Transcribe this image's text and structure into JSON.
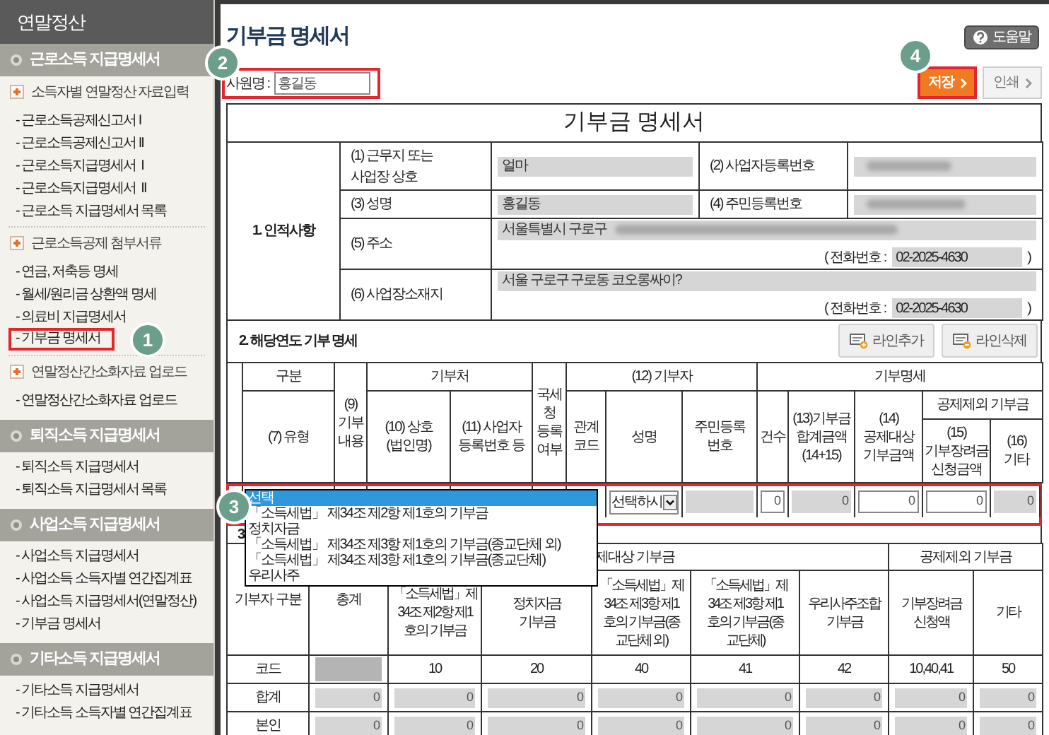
{
  "sidebar": {
    "title": "연말정산",
    "sections": [
      {
        "title": "근로소득 지급명세서",
        "groups": [
          {
            "heading": "소득자별 연말정산 자료입력",
            "items": [
              {
                "label": "- 근로소득공제신고서 I",
                "highlighted": false
              },
              {
                "label": "- 근로소득공제신고서 II",
                "highlighted": false
              },
              {
                "label": "- 근로소득지급명세서  I",
                "highlighted": false
              },
              {
                "label": "- 근로소득지급명세서  II",
                "highlighted": false
              },
              {
                "label": "- 근로소득 지급명세서 목록",
                "highlighted": false
              }
            ]
          },
          {
            "heading": "근로소득공제 첨부서류",
            "items": [
              {
                "label": "- 연금, 저축등 명세",
                "highlighted": false
              },
              {
                "label": "- 월세/원리금 상환액 명세",
                "highlighted": false
              },
              {
                "label": "- 의료비 지급명세서",
                "highlighted": false
              },
              {
                "label": "- 기부금 명세서",
                "highlighted": true,
                "callout": "1"
              }
            ]
          },
          {
            "heading": "연말정산간소화자료 업로드",
            "items": [
              {
                "label": "- 연말정산간소화자료 업로드",
                "highlighted": false
              }
            ]
          }
        ]
      },
      {
        "title": "퇴직소득 지급명세서",
        "groups": [
          {
            "items": [
              {
                "label": "- 퇴직소득 지급명세서",
                "highlighted": false
              },
              {
                "label": "- 퇴직소득 지급명세서 목록",
                "highlighted": false
              }
            ]
          }
        ]
      },
      {
        "title": "사업소득 지급명세서",
        "groups": [
          {
            "items": [
              {
                "label": "- 사업소득 지급명세서",
                "highlighted": false
              },
              {
                "label": "- 사업소득 소득자별 연간집계표",
                "highlighted": false
              },
              {
                "label": "- 사업소득 지급명세서(연말정산)",
                "highlighted": false
              },
              {
                "label": "- 기부금 명세서",
                "highlighted": false
              }
            ]
          }
        ]
      },
      {
        "title": "기타소득 지급명세서",
        "groups": [
          {
            "items": [
              {
                "label": "- 기타소득 지급명세서",
                "highlighted": false
              },
              {
                "label": "- 기타소득 소득자별 연간집계표",
                "highlighted": false
              }
            ]
          }
        ]
      }
    ]
  },
  "page": {
    "title": "기부금 명세서",
    "help_button": "도움말",
    "employee": {
      "label": "사원명 :",
      "value": "홍길동",
      "callout": "2"
    },
    "buttons": [
      {
        "label": "저장",
        "kind": "primary",
        "callout": "4"
      },
      {
        "label": "인쇄",
        "kind": "secondary"
      }
    ]
  },
  "form": {
    "title": "기부금 명세서",
    "personal": {
      "heading": "1. 인적사항",
      "workplace": {
        "label": "(1) 근무지 또는\n사업장 상호",
        "value": "얼마"
      },
      "business_no": {
        "label": "(2) 사업자등록번호",
        "redacted": true
      },
      "name": {
        "label": "(3) 성명",
        "value": "홍길동"
      },
      "resident_no": {
        "label": "(4) 주민등록번호",
        "redacted": true
      },
      "address": {
        "label": "(5) 주소",
        "value": "서울특별시 구로구",
        "redacted": true,
        "phone_label": "( 전화번호 :",
        "phone": "02-2025-4630",
        "phone_close": ")"
      },
      "business_address": {
        "label": "(6) 사업장소재지",
        "value": "서울 구로구 구로동 코오롱싸이?",
        "redacted": false,
        "phone_label": "( 전화번호 :",
        "phone": "02-2025-4630",
        "phone_close": ")"
      }
    },
    "donations": {
      "heading": "2. 해당연도 기부 명세",
      "buttons": [
        {
          "label": "라인추가",
          "kind": "add"
        },
        {
          "label": "라인삭제",
          "kind": "delete"
        }
      ],
      "headers": {
        "type_group": "구분",
        "type": "(7) 유형",
        "content": "(9)\n기부\n내용",
        "org_group": "기부처",
        "org_name": "(10) 상호\n(법인명)",
        "org_regno": "(11) 사업자\n등록번호 등",
        "nts": "국세\n청\n등록\n여부",
        "donor_group": "(12) 기부자",
        "relation": "관계\n코드",
        "name": "성명",
        "resident_no": "주민등록\n번호",
        "detail_group": "기부명세",
        "count": "건수",
        "total": "(13)기부금\n합계금액\n(14+15)",
        "deductible": "(14)\n공제대상\n기부금액",
        "excluded_group": "공제제외 기부금",
        "incentive": "(15)\n기부장려금\n신청금액",
        "other": "(16)\n기타"
      },
      "entry_row": {
        "callout": "3",
        "type_options": [
          {
            "label": "선택",
            "selected": true
          },
          {
            "label": "「소득세법」 제34조 제2항 제1호의 기부금",
            "selected": false
          },
          {
            "label": "정치자금",
            "selected": false
          },
          {
            "label": "「소득세법」 제34조 제3항 제1호의 기부금(종교단체 외)",
            "selected": false
          },
          {
            "label": "「소득세법」 제34조 제3항 제1호의 기부금(종교단체)",
            "selected": false
          },
          {
            "label": "우리사주",
            "selected": false
          }
        ],
        "name_select": "선택하시",
        "fields": [
          {
            "editable": false
          },
          {
            "value": "0",
            "editable": true
          },
          {
            "value": "0",
            "editable": false
          },
          {
            "value": "0",
            "editable": true
          },
          {
            "value": "0",
            "editable": true
          },
          {
            "value": "0",
            "editable": false
          }
        ]
      }
    },
    "summary": {
      "section_label": "3",
      "headers": {
        "donor_type": "기부자 구분",
        "total": "총계",
        "deductible_group": "제대상 기부금",
        "excluded_group": "공제제외 기부금",
        "deductible_columns": [
          "「소득세법」제\n34조 제2항 제1\n호의 기부금",
          "정치자금\n기부금",
          "「소득세법」제\n34조 제3항 제1\n호의 기부금(종\n교단체 외)",
          "「소득세법」제\n34조 제3항 제1\n호의 기부금(종\n교단체)",
          "우리사주조합\n기부금"
        ],
        "excluded_columns": [
          "기부장려금\n신청액",
          "기타"
        ]
      },
      "code_row": {
        "label": "코드",
        "codes": [
          "10",
          "20",
          "40",
          "41",
          "42",
          "10,40,41",
          "50"
        ]
      },
      "rows": [
        {
          "label": "합계",
          "values": [
            "0",
            "0",
            "0",
            "0",
            "0",
            "0",
            "0",
            "0"
          ]
        },
        {
          "label": "본인",
          "values": [
            "0",
            "0",
            "0",
            "0",
            "0",
            "0",
            "0",
            "0"
          ]
        }
      ]
    }
  }
}
